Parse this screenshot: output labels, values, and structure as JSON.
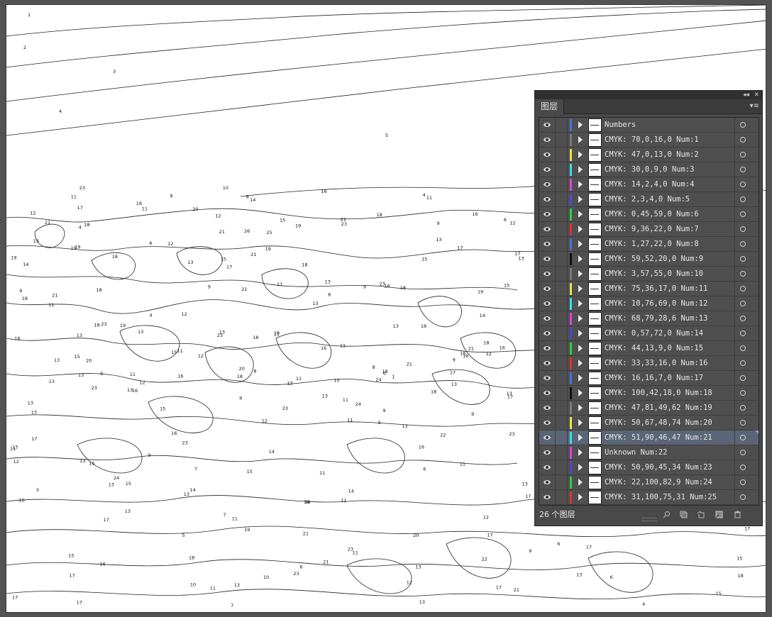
{
  "panel": {
    "collapse_glyph": "◂◂",
    "close_glyph": "✕",
    "tab_label": "图层",
    "menu_icon": "panel-menu-icon",
    "footer_count": "26 个图层",
    "footer_icons": [
      "search-icon",
      "collect-icon",
      "clip-mask-icon",
      "new-sublayer-icon",
      "new-layer-icon",
      "trash-icon"
    ],
    "layers": [
      {
        "name": "Numbers",
        "color": "#4a6fe0",
        "visible": true
      },
      {
        "name": "CMYK: 70,0,16,0 Num:1",
        "color": "#7a7a7a",
        "visible": true
      },
      {
        "name": "CMYK: 47,0,13,0 Num:2",
        "color": "#f0e040",
        "visible": true
      },
      {
        "name": "CMYK: 30,0,9,0 Num:3",
        "color": "#38e0e8",
        "visible": true
      },
      {
        "name": "CMYK: 14,2,4,0 Num:4",
        "color": "#e040e0",
        "visible": true
      },
      {
        "name": "CMYK: 2,3,4,0 Num:5",
        "color": "#4a4ad0",
        "visible": true
      },
      {
        "name": "CMYK: 0,45,59,0 Num:6",
        "color": "#30d040",
        "visible": true
      },
      {
        "name": "CMYK: 9,36,22,0 Num:7",
        "color": "#e03030",
        "visible": true
      },
      {
        "name": "CMYK: 1,27,22,0 Num:8",
        "color": "#4a6fe0",
        "visible": true
      },
      {
        "name": "CMYK: 59,52,20,0 Num:9",
        "color": "#111111",
        "visible": true
      },
      {
        "name": "CMYK: 3,57,55,0 Num:10",
        "color": "#7a7a7a",
        "visible": true
      },
      {
        "name": "CMYK: 75,36,17,0 Num:11",
        "color": "#f0e040",
        "visible": true
      },
      {
        "name": "CMYK: 10,76,69,0 Num:12",
        "color": "#38e0e8",
        "visible": true
      },
      {
        "name": "CMYK: 68,79,28,6 Num:13",
        "color": "#e040e0",
        "visible": true
      },
      {
        "name": "CMYK: 0,57,72,0 Num:14",
        "color": "#4a4ad0",
        "visible": true
      },
      {
        "name": "CMYK: 44,13,9,0 Num:15",
        "color": "#30d040",
        "visible": true
      },
      {
        "name": "CMYK: 33,33,16,0 Num:16",
        "color": "#e03030",
        "visible": true
      },
      {
        "name": "CMYK: 16,16,7,0 Num:17",
        "color": "#4a6fe0",
        "visible": true
      },
      {
        "name": "CMYK: 100,42,18,0 Num:18",
        "color": "#111111",
        "visible": true
      },
      {
        "name": "CMYK: 47,81,49,62 Num:19",
        "color": "#7a7a7a",
        "visible": true
      },
      {
        "name": "CMYK: 50,67,48,74 Num:20",
        "color": "#f0e040",
        "visible": true
      },
      {
        "name": "CMYK: 51,90,46,47 Num:21",
        "color": "#38e0e8",
        "visible": true,
        "selected": true
      },
      {
        "name": "Unknown Num:22",
        "color": "#e040e0",
        "visible": true
      },
      {
        "name": "CMYK: 50,90,45,34 Num:23",
        "color": "#4a4ad0",
        "visible": true
      },
      {
        "name": "CMYK: 22,100,82,9 Num:24",
        "color": "#30d040",
        "visible": true
      },
      {
        "name": "CMYK: 31,100,75,31 Num:25",
        "color": "#e03030",
        "visible": true
      }
    ]
  },
  "canvas": {
    "region_numbers": [
      "1",
      "2",
      "3",
      "4",
      "5",
      "5",
      "18",
      "11",
      "15",
      "9",
      "7",
      "6",
      "16",
      "17",
      "18",
      "11",
      "15",
      "9",
      "17",
      "6",
      "15",
      "11",
      "18",
      "13",
      "11",
      "17",
      "18",
      "9",
      "16",
      "13",
      "16",
      "17",
      "11",
      "17",
      "8",
      "18",
      "18",
      "9",
      "6",
      "17",
      "18",
      "11",
      "11",
      "18",
      "15",
      "17",
      "11",
      "18",
      "17",
      "17",
      "11",
      "13",
      "17",
      "18",
      "15",
      "11",
      "5",
      "18",
      "11",
      "20",
      "19",
      "11",
      "18",
      "11",
      "11",
      "18",
      "11",
      "15",
      "23",
      "16",
      "1",
      "10",
      "9",
      "15",
      "21",
      "4",
      "17",
      "11",
      "13",
      "21",
      "16",
      "17",
      "15",
      "15",
      "13",
      "12",
      "13",
      "17",
      "21",
      "11",
      "18",
      "9",
      "3",
      "13",
      "15",
      "13",
      "15",
      "8",
      "13",
      "18",
      "15",
      "14",
      "16",
      "13",
      "21",
      "9",
      "16",
      "12",
      "13",
      "12",
      "11",
      "21",
      "11",
      "13",
      "6",
      "13",
      "13",
      "13",
      "23",
      "22",
      "16",
      "13",
      "12",
      "23",
      "23",
      "21",
      "16",
      "13",
      "13",
      "23",
      "12",
      "13",
      "21",
      "23",
      "21",
      "19",
      "23",
      "13",
      "23",
      "23",
      "13",
      "20",
      "16",
      "17",
      "9",
      "13",
      "13",
      "21",
      "13",
      "16",
      "13",
      "23",
      "24",
      "13",
      "18",
      "20",
      "21",
      "19",
      "4",
      "16",
      "9",
      "16",
      "18",
      "13",
      "17",
      "13",
      "9",
      "23",
      "21",
      "9",
      "12",
      "13",
      "19",
      "19",
      "18",
      "20",
      "19",
      "24",
      "7",
      "12",
      "8",
      "10",
      "25",
      "13",
      "24",
      "26",
      "12",
      "10",
      "14",
      "14",
      "6",
      "4",
      "8",
      "12",
      "6",
      "12",
      "6",
      "9",
      "16",
      "15",
      "22",
      "14",
      "13",
      "19",
      "18",
      "17",
      "19",
      "10",
      "14",
      "12",
      "4",
      "16",
      "12",
      "14",
      "7"
    ]
  }
}
